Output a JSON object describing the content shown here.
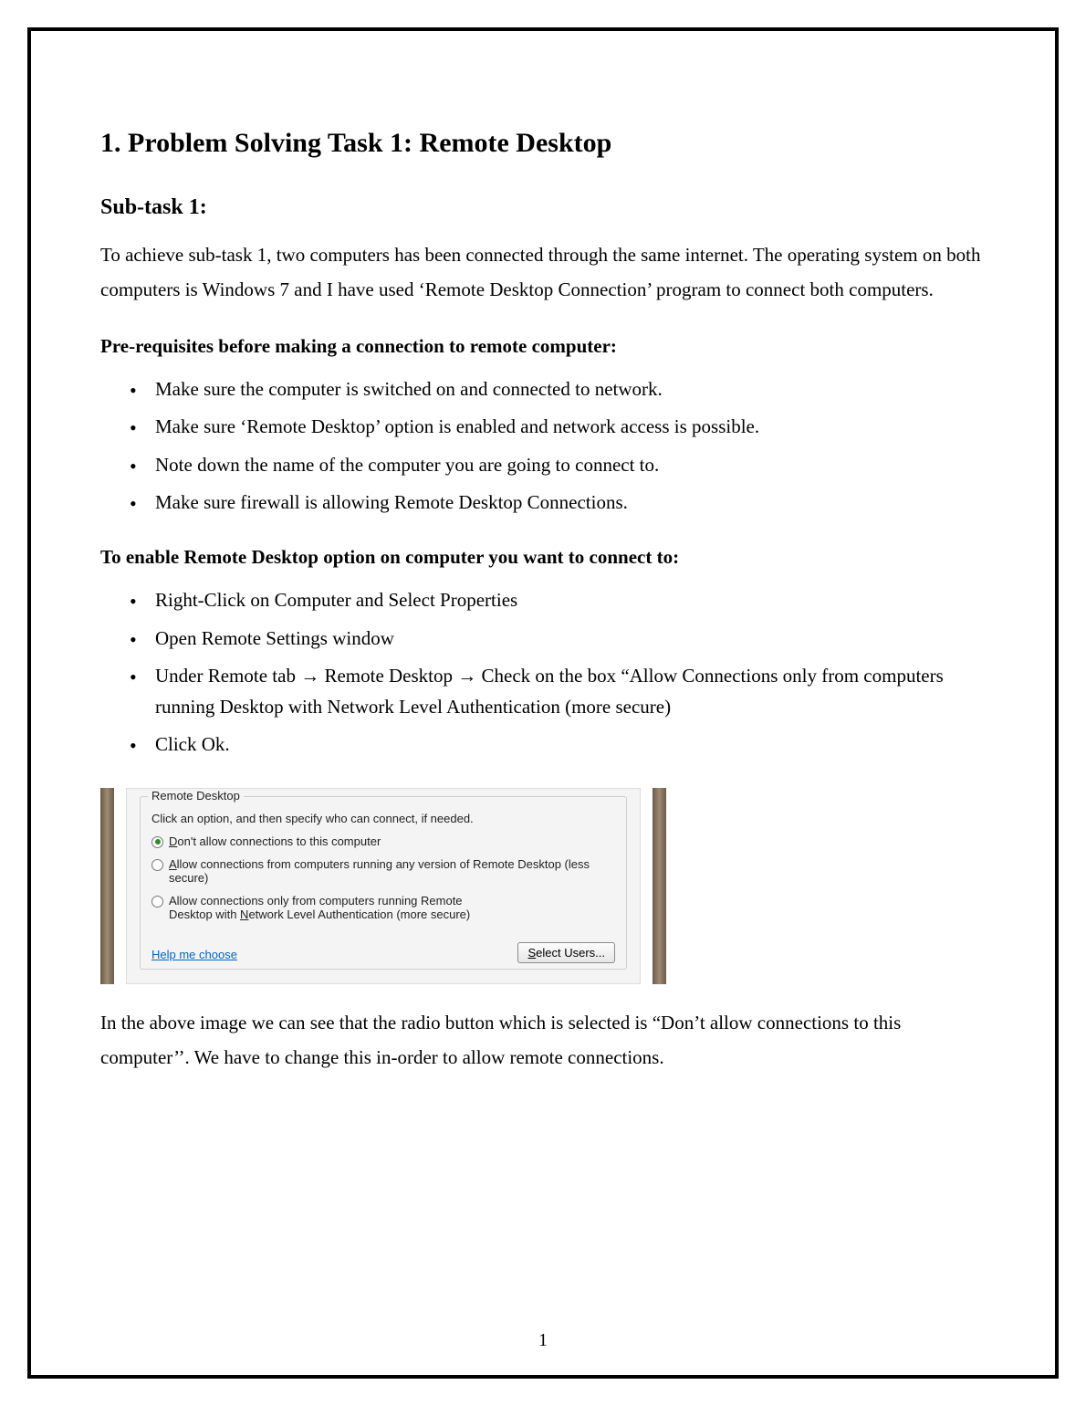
{
  "heading": "1. Problem Solving Task 1: Remote Desktop",
  "subtask_heading": "Sub-task 1:",
  "intro": "To achieve sub-task 1, two computers has been connected through the same internet. The operating system on both computers is Windows 7 and I have used ‘Remote Desktop Connection’ program to connect both computers.",
  "prereq_heading": "Pre-requisites before making a connection to remote computer:",
  "prereq_items": [
    "Make sure the computer is switched on and connected to network.",
    "Make sure ‘Remote Desktop’ option is enabled and network access is possible.",
    "Note down the name of the computer you are going to connect to.",
    "Make sure firewall is allowing Remote Desktop Connections."
  ],
  "enable_heading": "To enable Remote Desktop option on computer you want to connect to:",
  "enable_items": [
    "Right-Click on Computer and Select Properties",
    "Open Remote Settings window",
    "Under Remote tab → Remote Desktop → Check on the box “Allow Connections only from computers running Desktop with Network Level Authentication (more secure)",
    "Click Ok."
  ],
  "screenshot": {
    "group_legend": "Remote Desktop",
    "instruction": "Click an option, and then specify who can connect, if needed.",
    "option1": {
      "prefix": "D",
      "rest": "on't allow connections to this computer",
      "selected": true
    },
    "option2": {
      "prefix": "A",
      "rest": "llow connections from computers running any version of Remote Desktop (less secure)",
      "selected": false
    },
    "option3": {
      "line1_pre": "Allow connections only from computers running Remote",
      "line2_pre": "Desktop with ",
      "line2_u": "N",
      "line2_post": "etwork Level Authentication (more secure)",
      "selected": false
    },
    "help_link": "Help me choose",
    "select_users_p": "S",
    "select_users_rest": "elect Users..."
  },
  "closing": "In the above image we can see that the radio button which is selected is “Don’t allow connections to this computer’’. We have to change this in-order to allow remote connections.",
  "page_number": "1"
}
